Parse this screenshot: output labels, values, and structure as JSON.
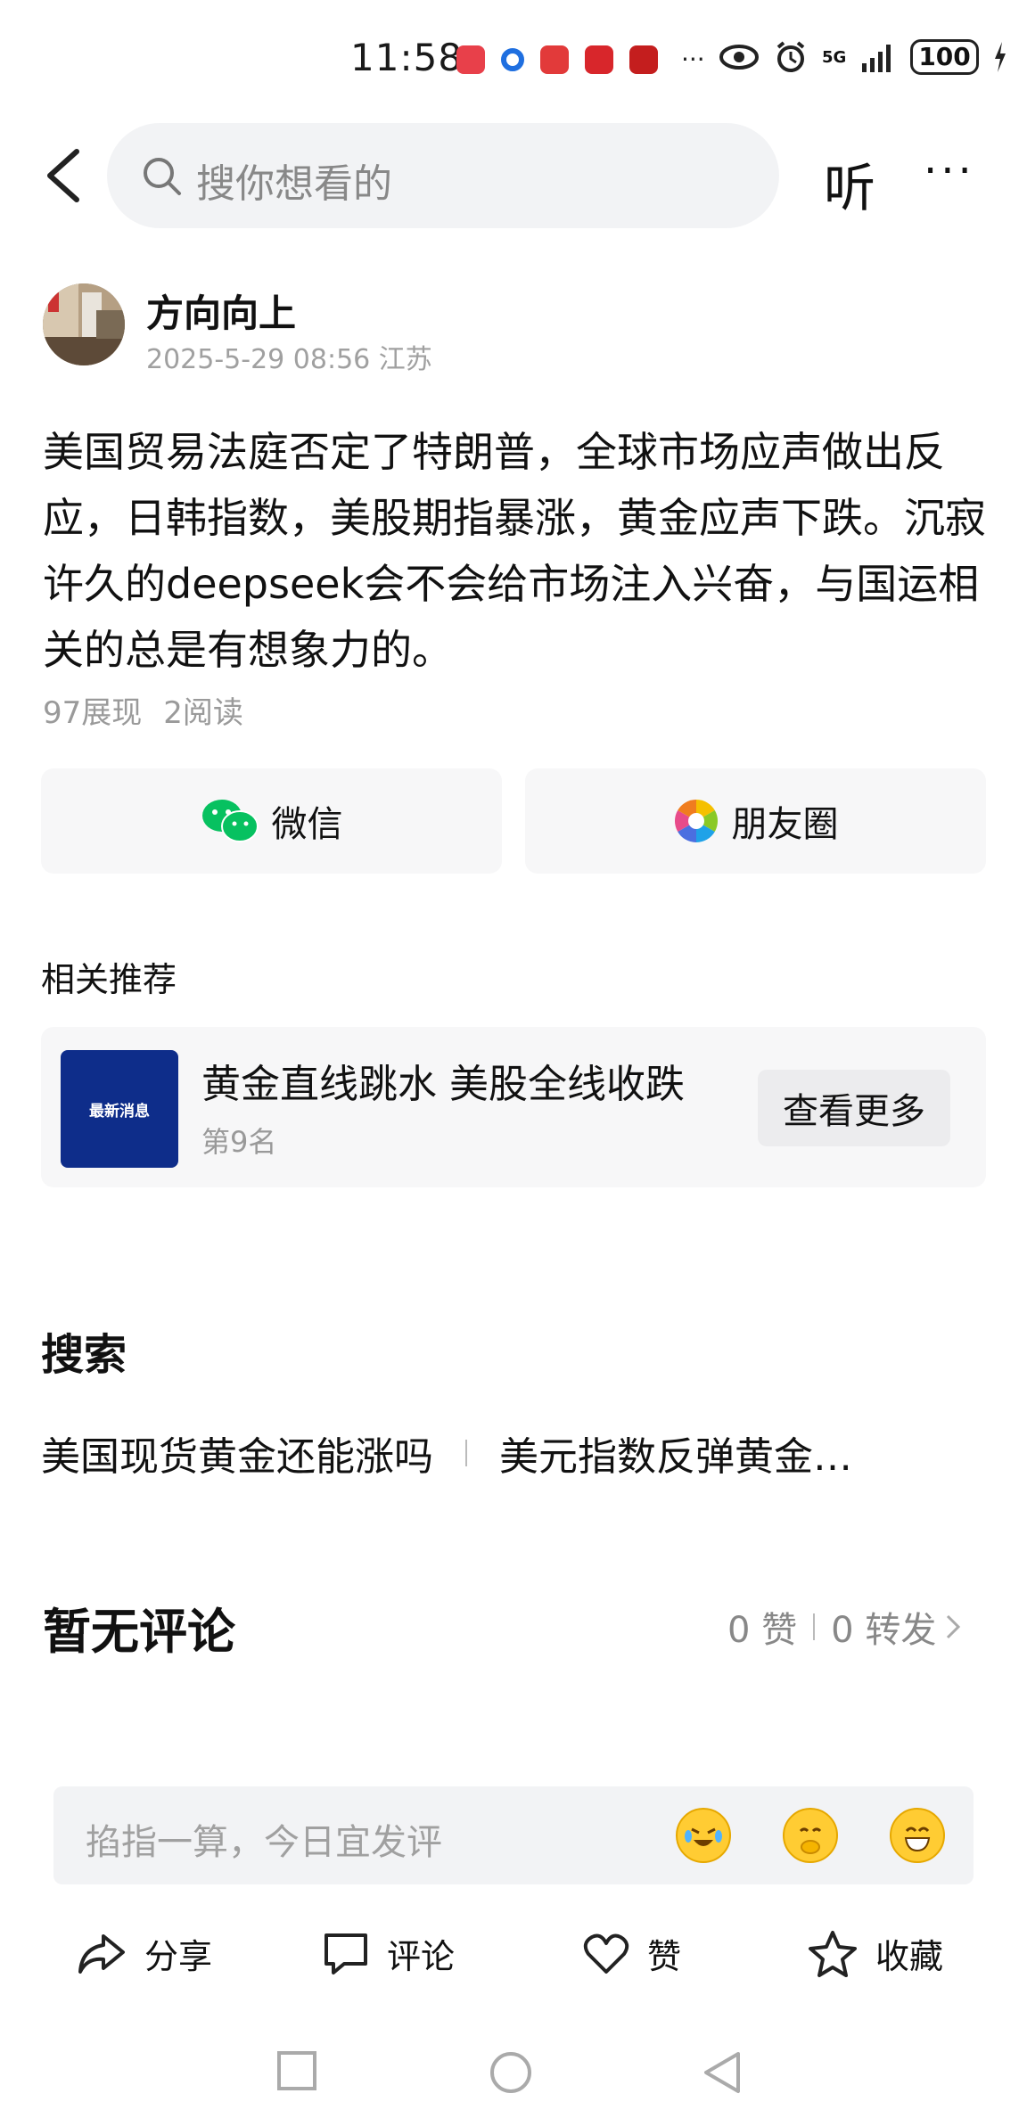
{
  "status_bar": {
    "time": "11:58",
    "network": "5G",
    "battery": "100",
    "more_apps": "···"
  },
  "nav": {
    "search_placeholder": "搜你想看的",
    "listen_label": "听",
    "more_label": "···"
  },
  "author": {
    "name": "方向向上",
    "meta": "2025-5-29 08:56 江苏"
  },
  "post": {
    "text": "美国贸易法庭否定了特朗普，全球市场应声做出反应，日韩指数，美股期指暴涨，黄金应声下跌。沉寂许久的deepseek会不会给市场注入兴奋，与国运相关的总是有想象力的。",
    "impressions": "97展现",
    "reads": "2阅读"
  },
  "share": {
    "wechat_label": "微信",
    "moments_label": "朋友圈"
  },
  "related": {
    "title": "相关推荐",
    "thumb_text": "最新消息",
    "headline": "黄金直线跳水 美股全线收跌",
    "rank": "第9名",
    "view_more": "查看更多"
  },
  "search": {
    "title": "搜索",
    "items": [
      "美国现货黄金还能涨吗",
      "美元指数反弹黄金…"
    ]
  },
  "comments": {
    "title": "暂无评论",
    "likes": "0 赞",
    "forwards": "0 转发"
  },
  "comment_input": {
    "placeholder": "掐指一算，今日宜发评"
  },
  "actions": {
    "share": "分享",
    "comment": "评论",
    "like": "赞",
    "favorite": "收藏"
  },
  "colors": {
    "wechat_green": "#07c160",
    "thumb_blue": "#0e2d8a",
    "muted_text": "#9a9a9a"
  }
}
